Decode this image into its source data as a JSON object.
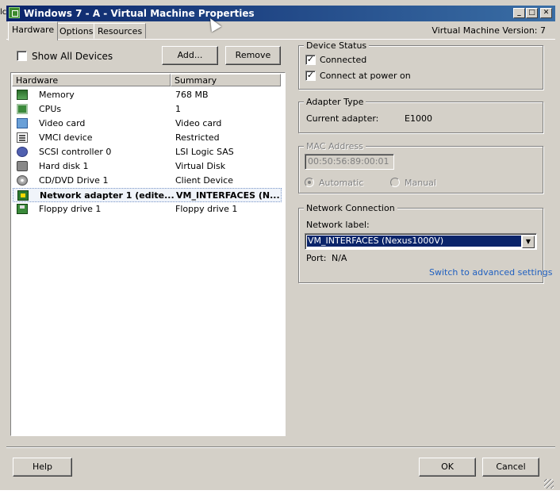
{
  "window": {
    "title": "Windows 7 - A - Virtual Machine Properties",
    "vm_version": "Virtual Machine Version: 7",
    "min_label": "_",
    "max_label": "□",
    "close_label": "✕"
  },
  "bg_left_text": "lc",
  "tabs": [
    {
      "label": "Hardware",
      "active": true
    },
    {
      "label": "Options",
      "active": false
    },
    {
      "label": "Resources",
      "active": false
    }
  ],
  "hardware": {
    "show_all_label": "Show All Devices",
    "show_all_checked": false,
    "add_label": "Add...",
    "remove_label": "Remove",
    "col_hardware": "Hardware",
    "col_summary": "Summary",
    "rows": [
      {
        "name": "Memory",
        "summary": "768 MB",
        "icon": "memory-icon"
      },
      {
        "name": "CPUs",
        "summary": "1",
        "icon": "cpu-icon"
      },
      {
        "name": "Video card",
        "summary": "Video card",
        "icon": "monitor-icon"
      },
      {
        "name": "VMCI device",
        "summary": "Restricted",
        "icon": "vmci-icon"
      },
      {
        "name": "SCSI controller 0",
        "summary": "LSI Logic SAS",
        "icon": "scsi-icon"
      },
      {
        "name": "Hard disk 1",
        "summary": "Virtual Disk",
        "icon": "hard-disk-icon"
      },
      {
        "name": "CD/DVD Drive 1",
        "summary": "Client Device",
        "icon": "cd-icon"
      },
      {
        "name": "Network adapter 1 (edite...",
        "summary": "VM_INTERFACES (N...",
        "icon": "network-adapter-icon",
        "selected": true
      },
      {
        "name": "Floppy drive 1",
        "summary": "Floppy drive 1",
        "icon": "floppy-icon"
      }
    ]
  },
  "device_status": {
    "title": "Device Status",
    "connected_label": "Connected",
    "connected_checked": true,
    "power_on_label": "Connect at power on",
    "power_on_checked": true,
    "check_mark": "✓"
  },
  "adapter_type": {
    "title": "Adapter Type",
    "current_label": "Current adapter:",
    "current_value": "E1000"
  },
  "mac_address": {
    "title": "MAC Address",
    "value": "00:50:56:89:00:01",
    "automatic_label": "Automatic",
    "manual_label": "Manual"
  },
  "network_connection": {
    "title": "Network Connection",
    "label_caption": "Network label:",
    "selected": "VM_INTERFACES (Nexus1000V)",
    "port_label": "Port:",
    "port_value": "N/A",
    "advanced_link": "Switch to advanced settings",
    "arrow": "▼"
  },
  "footer": {
    "help_label": "Help",
    "ok_label": "OK",
    "cancel_label": "Cancel"
  }
}
